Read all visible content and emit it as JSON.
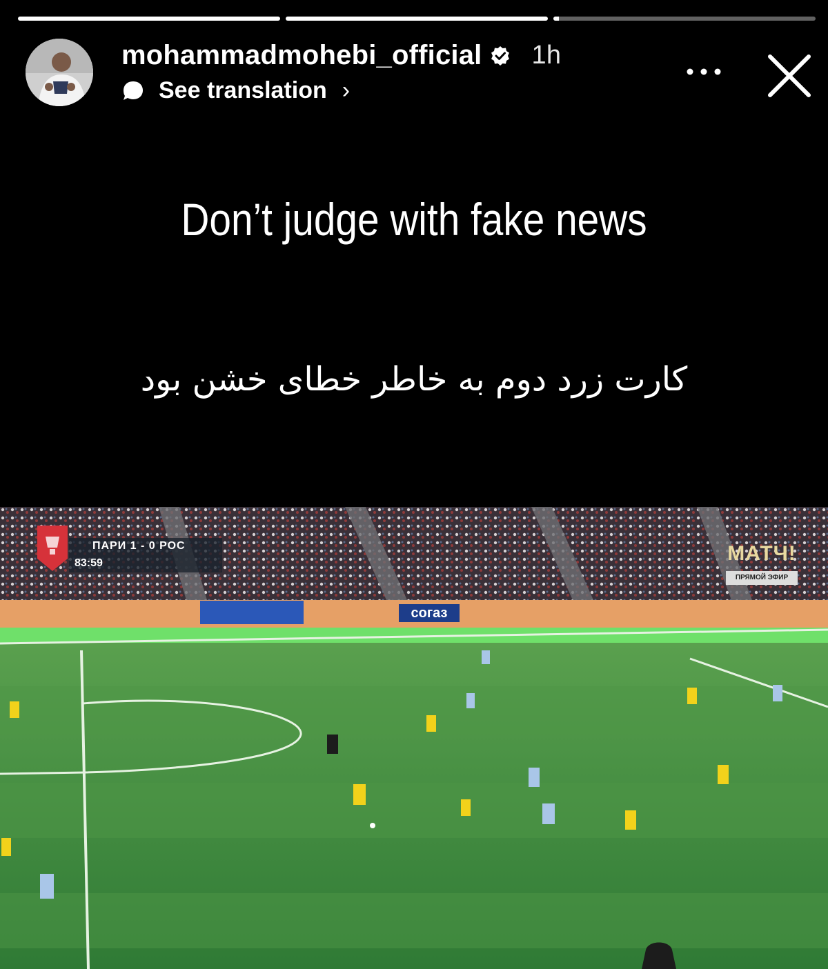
{
  "story": {
    "progress": [
      1.0,
      1.0,
      0.02
    ],
    "username": "mohammadmohebi_official",
    "time_ago": "1h",
    "translate_label": "See translation",
    "headline": "Don’t judge with fake news",
    "persian_caption": "کارت زرد دوم به خاطر خطای خشن بود"
  },
  "icons": {
    "verified": "verified-badge-icon",
    "translate": "speech-bubble-icon",
    "more": "more-options-icon",
    "close": "close-icon",
    "chevron": "chevron-right-icon"
  },
  "broadcast": {
    "teams": "ПАРИ 1 - 0 РОС",
    "clock": "83:59",
    "channel": "МАТЧ!",
    "channel_sub": "ПРЯМОЙ ЭФИР",
    "sponsor": "согаз"
  },
  "colors": {
    "background": "#000000",
    "text": "#ffffff",
    "pitch": "#3f8a3c",
    "yellow_team": "#f2d21b",
    "blue_team": "#a9c6e8"
  }
}
